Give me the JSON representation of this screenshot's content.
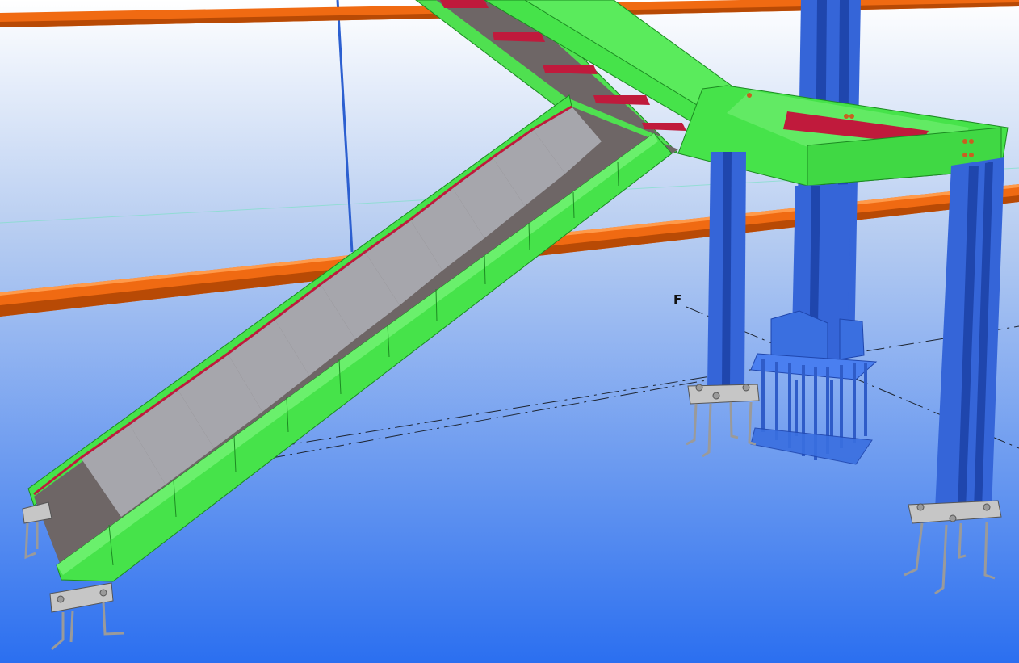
{
  "viewport": {
    "grid_label": "F"
  },
  "colors": {
    "sky_top": "#ffffff",
    "sky_mid": "#b7cdf1",
    "sky_bottom": "#2b6ff0",
    "stringer": "#46e34a",
    "stringer_edge": "#1c8a22",
    "column": "#3565d8",
    "column_dark": "#1f46ad",
    "beam_orange": "#f06a12",
    "beam_orange_dark": "#b84a05",
    "tread_top": "#6e6666",
    "tread_riser": "#a6a6ac",
    "nosing": "#c01a3c",
    "baseplate": "#c6c6c6",
    "bolt": "#9a9a9a"
  }
}
